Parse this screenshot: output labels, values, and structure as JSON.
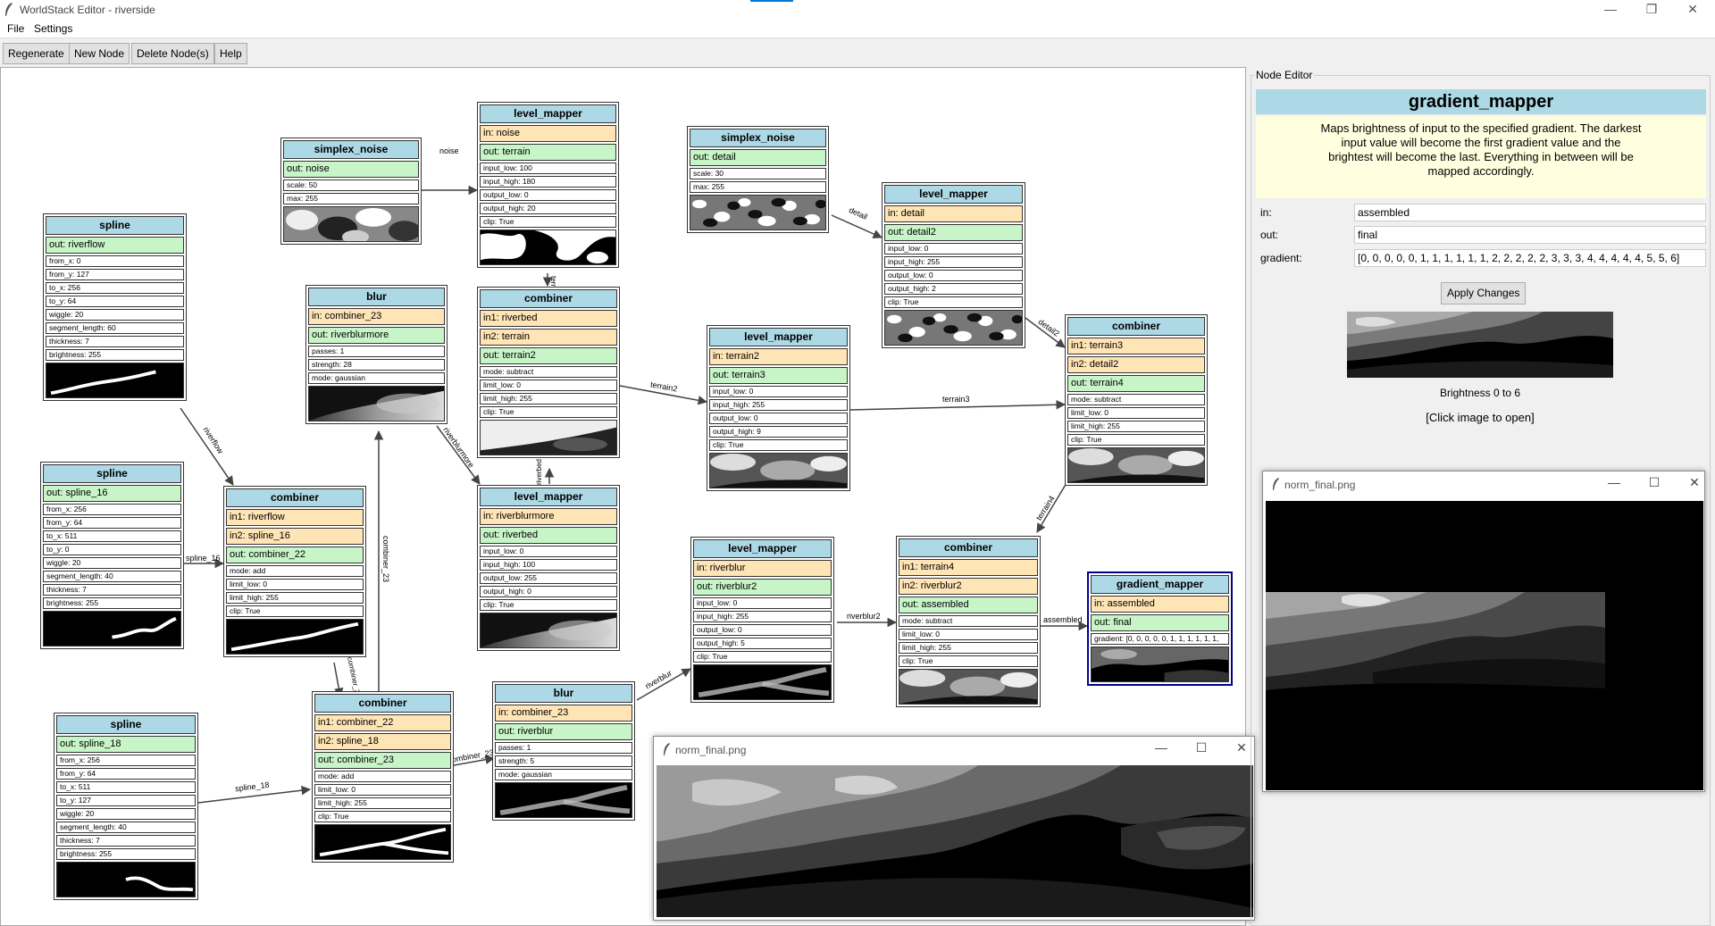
{
  "window": {
    "title": "WorldStack Editor - riverside"
  },
  "menu": [
    "File",
    "Settings"
  ],
  "toolbar": [
    "Regenerate",
    "New Node",
    "Delete Node(s)",
    "Help"
  ],
  "nodes": {
    "n1": {
      "title": "simplex_noise",
      "rows": [
        [
          "out",
          "out: noise"
        ],
        [
          "p",
          "scale: 50"
        ],
        [
          "p",
          "max: 255"
        ]
      ]
    },
    "n2": {
      "title": "level_mapper",
      "rows": [
        [
          "in",
          "in: noise"
        ],
        [
          "out",
          "out: terrain"
        ],
        [
          "p",
          "input_low: 100"
        ],
        [
          "p",
          "input_high: 180"
        ],
        [
          "p",
          "output_low: 0"
        ],
        [
          "p",
          "output_high: 20"
        ],
        [
          "p",
          "clip: True"
        ]
      ]
    },
    "n3": {
      "title": "simplex_noise",
      "rows": [
        [
          "out",
          "out: detail"
        ],
        [
          "p",
          "scale: 30"
        ],
        [
          "p",
          "max: 255"
        ]
      ]
    },
    "n4": {
      "title": "level_mapper",
      "rows": [
        [
          "in",
          "in: detail"
        ],
        [
          "out",
          "out: detail2"
        ],
        [
          "p",
          "input_low: 0"
        ],
        [
          "p",
          "input_high: 255"
        ],
        [
          "p",
          "output_low: 0"
        ],
        [
          "p",
          "output_high: 2"
        ],
        [
          "p",
          "clip: True"
        ]
      ]
    },
    "n5": {
      "title": "spline",
      "rows": [
        [
          "out",
          "out: riverflow"
        ],
        [
          "p",
          "from_x: 0"
        ],
        [
          "p",
          "from_y: 127"
        ],
        [
          "p",
          "to_x: 256"
        ],
        [
          "p",
          "to_y: 64"
        ],
        [
          "p",
          "wiggle: 20"
        ],
        [
          "p",
          "segment_length: 60"
        ],
        [
          "p",
          "thickness: 7"
        ],
        [
          "p",
          "brightness: 255"
        ]
      ]
    },
    "n6": {
      "title": "blur",
      "rows": [
        [
          "in",
          "in: combiner_23"
        ],
        [
          "out",
          "out: riverblurmore"
        ],
        [
          "p",
          "passes: 1"
        ],
        [
          "p",
          "strength: 28"
        ],
        [
          "p",
          "mode: gaussian"
        ]
      ]
    },
    "n7": {
      "title": "combiner",
      "rows": [
        [
          "in",
          "in1: riverbed"
        ],
        [
          "in",
          "in2: terrain"
        ],
        [
          "out",
          "out: terrain2"
        ],
        [
          "p",
          "mode: subtract"
        ],
        [
          "p",
          "limit_low: 0"
        ],
        [
          "p",
          "limit_high: 255"
        ],
        [
          "p",
          "clip: True"
        ]
      ]
    },
    "n8": {
      "title": "level_mapper",
      "rows": [
        [
          "in",
          "in: terrain2"
        ],
        [
          "out",
          "out: terrain3"
        ],
        [
          "p",
          "input_low: 0"
        ],
        [
          "p",
          "input_high: 255"
        ],
        [
          "p",
          "output_low: 0"
        ],
        [
          "p",
          "output_high: 9"
        ],
        [
          "p",
          "clip: True"
        ]
      ]
    },
    "n9": {
      "title": "combiner",
      "rows": [
        [
          "in",
          "in1: terrain3"
        ],
        [
          "in",
          "in2: detail2"
        ],
        [
          "out",
          "out: terrain4"
        ],
        [
          "p",
          "mode: subtract"
        ],
        [
          "p",
          "limit_low: 0"
        ],
        [
          "p",
          "limit_high: 255"
        ],
        [
          "p",
          "clip: True"
        ]
      ]
    },
    "n10": {
      "title": "spline",
      "rows": [
        [
          "out",
          "out: spline_16"
        ],
        [
          "p",
          "from_x: 256"
        ],
        [
          "p",
          "from_y: 64"
        ],
        [
          "p",
          "to_x: 511"
        ],
        [
          "p",
          "to_y: 0"
        ],
        [
          "p",
          "wiggle: 20"
        ],
        [
          "p",
          "segment_length: 40"
        ],
        [
          "p",
          "thickness: 7"
        ],
        [
          "p",
          "brightness: 255"
        ]
      ]
    },
    "n11": {
      "title": "combiner",
      "rows": [
        [
          "in",
          "in1: riverflow"
        ],
        [
          "in",
          "in2: spline_16"
        ],
        [
          "out",
          "out: combiner_22"
        ],
        [
          "p",
          "mode: add"
        ],
        [
          "p",
          "limit_low: 0"
        ],
        [
          "p",
          "limit_high: 255"
        ],
        [
          "p",
          "clip: True"
        ]
      ]
    },
    "n12": {
      "title": "level_mapper",
      "rows": [
        [
          "in",
          "in: riverblurmore"
        ],
        [
          "out",
          "out: riverbed"
        ],
        [
          "p",
          "input_low: 0"
        ],
        [
          "p",
          "input_high: 100"
        ],
        [
          "p",
          "output_low: 255"
        ],
        [
          "p",
          "output_high: 0"
        ],
        [
          "p",
          "clip: True"
        ]
      ]
    },
    "n13": {
      "title": "level_mapper",
      "rows": [
        [
          "in",
          "in: riverblur"
        ],
        [
          "out",
          "out: riverblur2"
        ],
        [
          "p",
          "input_low: 0"
        ],
        [
          "p",
          "input_high: 255"
        ],
        [
          "p",
          "output_low: 0"
        ],
        [
          "p",
          "output_high: 5"
        ],
        [
          "p",
          "clip: True"
        ]
      ]
    },
    "n14": {
      "title": "combiner",
      "rows": [
        [
          "in",
          "in1: terrain4"
        ],
        [
          "in",
          "in2: riverblur2"
        ],
        [
          "out",
          "out: assembled"
        ],
        [
          "p",
          "mode: subtract"
        ],
        [
          "p",
          "limit_low: 0"
        ],
        [
          "p",
          "limit_high: 255"
        ],
        [
          "p",
          "clip: True"
        ]
      ]
    },
    "n15": {
      "title": "gradient_mapper",
      "rows": [
        [
          "in",
          "in: assembled"
        ],
        [
          "out",
          "out: final"
        ],
        [
          "p",
          "gradient: [0, 0, 0, 0, 0, 1, 1, 1, 1, 1, 1,"
        ]
      ]
    },
    "n16": {
      "title": "spline",
      "rows": [
        [
          "out",
          "out: spline_18"
        ],
        [
          "p",
          "from_x: 256"
        ],
        [
          "p",
          "from_y: 64"
        ],
        [
          "p",
          "to_x: 511"
        ],
        [
          "p",
          "to_y: 127"
        ],
        [
          "p",
          "wiggle: 20"
        ],
        [
          "p",
          "segment_length: 40"
        ],
        [
          "p",
          "thickness: 7"
        ],
        [
          "p",
          "brightness: 255"
        ]
      ]
    },
    "n17": {
      "title": "combiner",
      "rows": [
        [
          "in",
          "in1: combiner_22"
        ],
        [
          "in",
          "in2: spline_18"
        ],
        [
          "out",
          "out: combiner_23"
        ],
        [
          "p",
          "mode: add"
        ],
        [
          "p",
          "limit_low: 0"
        ],
        [
          "p",
          "limit_high: 255"
        ],
        [
          "p",
          "clip: True"
        ]
      ]
    },
    "n18": {
      "title": "blur",
      "rows": [
        [
          "in",
          "in: combiner_23"
        ],
        [
          "out",
          "out: riverblur"
        ],
        [
          "p",
          "passes: 1"
        ],
        [
          "p",
          "strength: 5"
        ],
        [
          "p",
          "mode: gaussian"
        ]
      ]
    }
  },
  "edge_labels": {
    "noise": "noise",
    "terrain": "terrain",
    "detail": "detail",
    "detail2": "detail2",
    "riverflow": "riverflow",
    "terrain2": "terrain2",
    "terrain3": "terrain3",
    "riverblurmore": "riverblurmore",
    "riverbed": "riverbed",
    "combiner_23a": "combiner_23",
    "spline_16": "spline_16",
    "combiner_22": "combiner_22",
    "terrain4": "terrain4",
    "riverblur": "riverblur",
    "riverblur2": "riverblur2",
    "assembled": "assembled",
    "spline_18": "spline_18",
    "combiner_23b": "combiner_23"
  },
  "editor": {
    "legend": "Node Editor",
    "title": "gradient_mapper",
    "description": "Maps brightness of input to the specified gradient. The darkest input value will become the first gradient value and the brightest will become the last. Everything in between will be mapped accordingly.",
    "in_label": "in:",
    "in_value": "assembled",
    "out_label": "out:",
    "out_value": "final",
    "gradient_label": "gradient:",
    "gradient_value": "[0, 0, 0, 0, 0, 1, 1, 1, 1, 1, 1, 2, 2, 2, 2, 2, 3, 3, 3, 4, 4, 4, 4, 4, 5, 5, 6]",
    "apply_label": "Apply Changes",
    "brightness_text": "Brightness 0 to 6",
    "click_text": "[Click image to open]"
  },
  "popups": {
    "a": {
      "title": "norm_final.png"
    },
    "b": {
      "title": "norm_final.png"
    }
  },
  "colors": {
    "title_bar": "#add8e6",
    "input_port": "#ffe4b5",
    "output_port": "#c8f5c8",
    "description_bg": "#ffffe0",
    "selected_border": "#00008b"
  }
}
